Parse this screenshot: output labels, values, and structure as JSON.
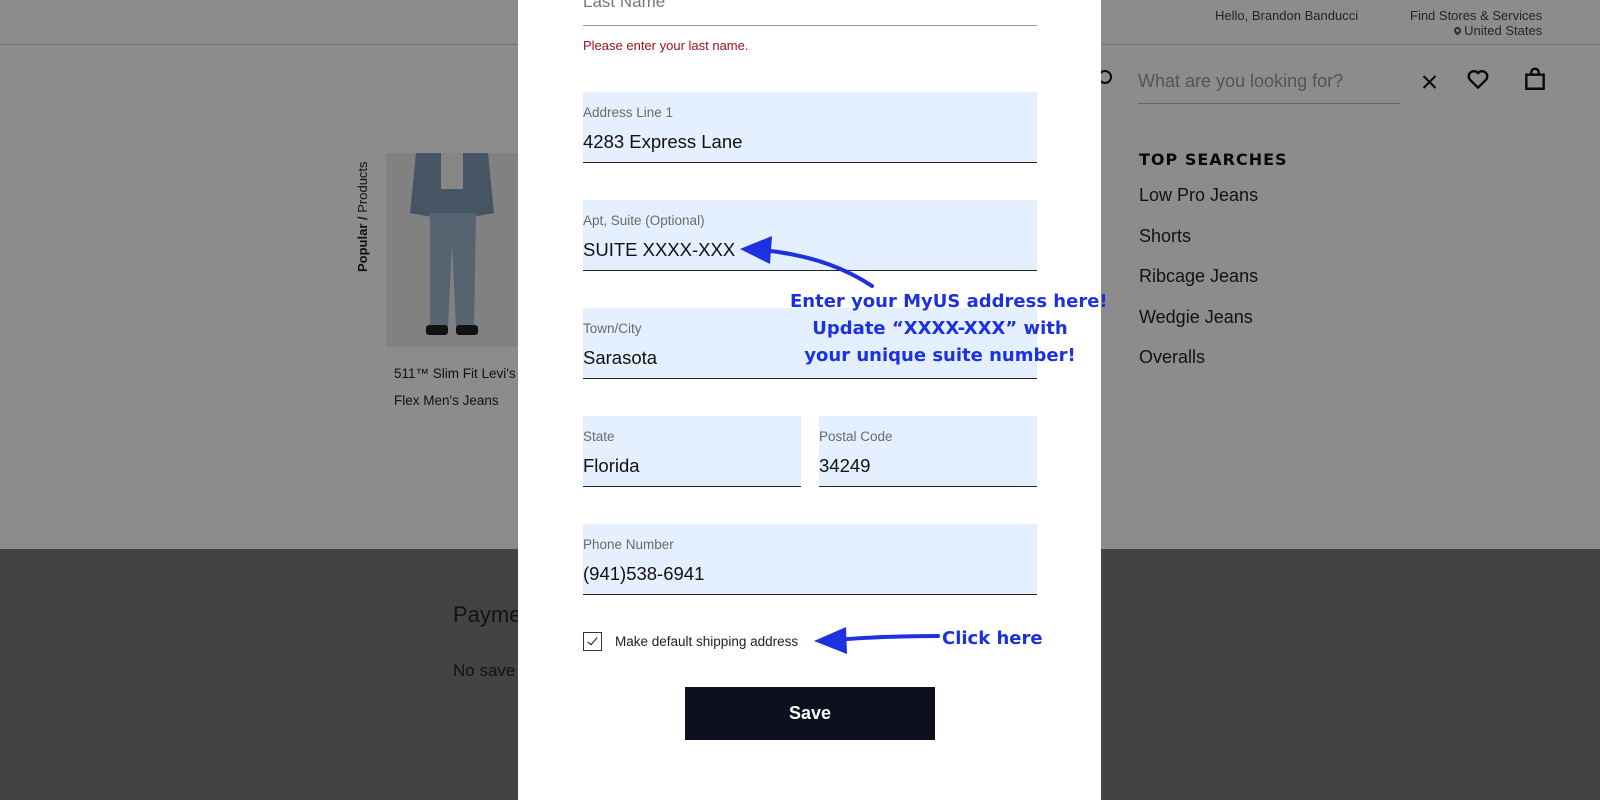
{
  "header": {
    "greeting": "Hello, Brandon Banducci",
    "stores_link": "Find Stores & Services",
    "location": "United States"
  },
  "search": {
    "placeholder": "What are you looking for?",
    "value": ""
  },
  "top_searches": {
    "title": "TOP SEARCHES",
    "items": [
      "Low Pro Jeans",
      "Shorts",
      "Ribcage Jeans",
      "Wedgie Jeans",
      "Overalls"
    ]
  },
  "popular": {
    "label_bold": "Popular /",
    "label_rest": " Products",
    "product_name": "511™ Slim Fit Levi's Flex Men's Jeans"
  },
  "account": {
    "payments_title": "Payme",
    "no_saved": "No save"
  },
  "form": {
    "last_name": {
      "label": "Last Name",
      "error": "Please enter your last name."
    },
    "address1": {
      "label": "Address Line 1",
      "value": "4283 Express Lane"
    },
    "address2": {
      "label": "Apt, Suite (Optional)",
      "value": "SUITE XXXX-XXX"
    },
    "city": {
      "label": "Town/City",
      "value": "Sarasota"
    },
    "state": {
      "label": "State",
      "value": "Florida"
    },
    "postal": {
      "label": "Postal Code",
      "value": "34249"
    },
    "phone": {
      "label": "Phone Number",
      "value": "(941)538-6941"
    },
    "default_checkbox": {
      "label": "Make default shipping address",
      "checked": true
    },
    "save_label": "Save"
  },
  "annotations": {
    "main_line1": "Enter your MyUS address here!",
    "main_line2": "Update “XXXX-XXX” with",
    "main_line3": "your unique suite number!",
    "click_here": "Click here",
    "color": "#1c31e0"
  },
  "icons": [
    "search-icon",
    "close-icon",
    "heart-icon",
    "bag-icon",
    "location-pin-icon",
    "checkbox-check-icon",
    "arrow-icon"
  ]
}
